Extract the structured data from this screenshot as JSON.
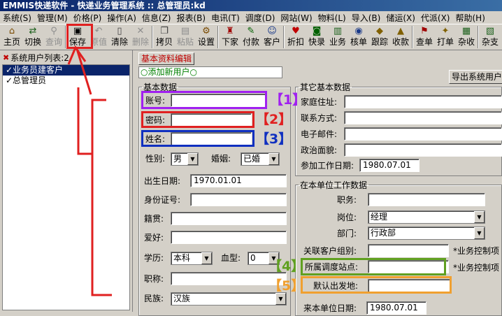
{
  "title": "EMMIS快递软件 - 快递业务管理系统 :: 总管理员:kd",
  "menu": [
    "系统(S)",
    "管理(M)",
    "价格(P)",
    "操作(A)",
    "信息(Z)",
    "报表(B)",
    "电讯(T)",
    "调度(D)",
    "网站(W)",
    "物料(L)",
    "导入(B)",
    "储运(X)",
    "代派(X)",
    "帮助(H)"
  ],
  "toolbar": [
    {
      "label": "主页",
      "icon": "home-icon",
      "glyph": "⌂",
      "color": "#7a4a00",
      "disabled": false
    },
    {
      "label": "切换",
      "icon": "switch-icon",
      "glyph": "⇄",
      "color": "#1a5f1a",
      "disabled": false
    },
    {
      "label": "查询",
      "icon": "search-icon",
      "glyph": "⚲",
      "color": "#8e8e8e",
      "disabled": true
    },
    {
      "label": "保存",
      "icon": "save-icon",
      "glyph": "▣",
      "color": "#000000",
      "disabled": false
    },
    {
      "label": "原值",
      "icon": "undo-icon",
      "glyph": "↶",
      "color": "#8e8e8e",
      "disabled": true
    },
    {
      "label": "清除",
      "icon": "clear-icon",
      "glyph": "▯",
      "color": "#404040",
      "disabled": false
    },
    {
      "label": "删除",
      "icon": "delete-icon",
      "glyph": "✕",
      "color": "#8e8e8e",
      "disabled": true
    },
    {
      "label": "拷贝",
      "icon": "copy-icon",
      "glyph": "❐",
      "color": "#404040",
      "disabled": false
    },
    {
      "label": "粘贴",
      "icon": "paste-icon",
      "glyph": "▤",
      "color": "#8e8e8e",
      "disabled": true
    },
    {
      "label": "设置",
      "icon": "settings-icon",
      "glyph": "⚙",
      "color": "#7a4a00",
      "disabled": false
    },
    {
      "label": "下家",
      "icon": "next-icon",
      "glyph": "♜",
      "color": "#a00000",
      "disabled": false
    },
    {
      "label": "付款",
      "icon": "payment-icon",
      "glyph": "✎",
      "color": "#006000",
      "disabled": false
    },
    {
      "label": "客户",
      "icon": "customers-icon",
      "glyph": "☺",
      "color": "#1a3a8a",
      "disabled": false
    },
    {
      "label": "折扣",
      "icon": "discount-icon",
      "glyph": "♥",
      "color": "#c00000",
      "disabled": false
    },
    {
      "label": "快录",
      "icon": "quick-entry-icon",
      "glyph": "◙",
      "color": "#006000",
      "disabled": false
    },
    {
      "label": "业务",
      "icon": "business-icon",
      "glyph": "▥",
      "color": "#1a5f1a",
      "disabled": false
    },
    {
      "label": "核单",
      "icon": "verify-icon",
      "glyph": "◉",
      "color": "#1a3a8a",
      "disabled": false
    },
    {
      "label": "跟踪",
      "icon": "track-icon",
      "glyph": "◆",
      "color": "#806000",
      "disabled": false
    },
    {
      "label": "收款",
      "icon": "receive-icon",
      "glyph": "▲",
      "color": "#806000",
      "disabled": false
    },
    {
      "label": "查单",
      "icon": "query-icon",
      "glyph": "⚑",
      "color": "#a00000",
      "disabled": false
    },
    {
      "label": "打单",
      "icon": "print-icon",
      "glyph": "✦",
      "color": "#806000",
      "disabled": false
    },
    {
      "label": "杂收",
      "icon": "misc-receive-icon",
      "glyph": "▦",
      "color": "#1a5f1a",
      "disabled": false
    },
    {
      "label": "杂支",
      "icon": "misc-pay-icon",
      "glyph": "▧",
      "color": "#1a5f1a",
      "disabled": false
    }
  ],
  "tree": {
    "header": "系统用户列表:2",
    "items": [
      "✓业务员建客户",
      "✓总管理员"
    ]
  },
  "main": {
    "tab": "基本资料编辑",
    "add_new": "○添加新用户○",
    "export": "导出系统用户资料",
    "basic": {
      "legend": "基本数据",
      "account": "账号:",
      "password": "密码:",
      "name": "姓名:",
      "gender_label": "性别:",
      "gender": "男",
      "marriage_label": "婚姻:",
      "marriage": "已婚",
      "birth_label": "出生日期:",
      "birth": "1970.01.01",
      "id_label": "身份证号:",
      "native_label": "籍贯:",
      "hobby_label": "爱好:",
      "edu_label": "学历:",
      "edu": "本科",
      "blood_label": "血型:",
      "blood": "0",
      "title_label": "职称:",
      "ethnic_label": "民族:",
      "ethnic": "汉族"
    },
    "other": {
      "legend": "其它基本数据",
      "address": "家庭住址:",
      "contact": "联系方式:",
      "email": "电子邮件:",
      "politics": "政治面貌:",
      "work_date_label": "参加工作日期:",
      "work_date": "1980.07.01"
    },
    "unit": {
      "legend": "在本单位工作数据",
      "job": "职务:",
      "post_label": "岗位:",
      "post": "经理",
      "dept_label": "部门:",
      "dept": "行政部",
      "group_label": "关联客户组别:",
      "group_note": "*业务控制项",
      "station_label": "所属调度站点:",
      "station_note": "*业务控制项",
      "origin_label": "默认出发地:",
      "join_date_label": "来本单位日期:",
      "join_date": "1980.07.01"
    }
  },
  "annotations": [
    "【1】",
    "【2】",
    "【3】",
    "【4】",
    "【5】"
  ],
  "colors": {
    "ann1": "#a020f0",
    "ann2": "#e02020",
    "ann3": "#1030c0",
    "ann4": "#60a020",
    "ann5": "#f0a030",
    "save_box": "#e02020",
    "arrow": "#e02020"
  }
}
